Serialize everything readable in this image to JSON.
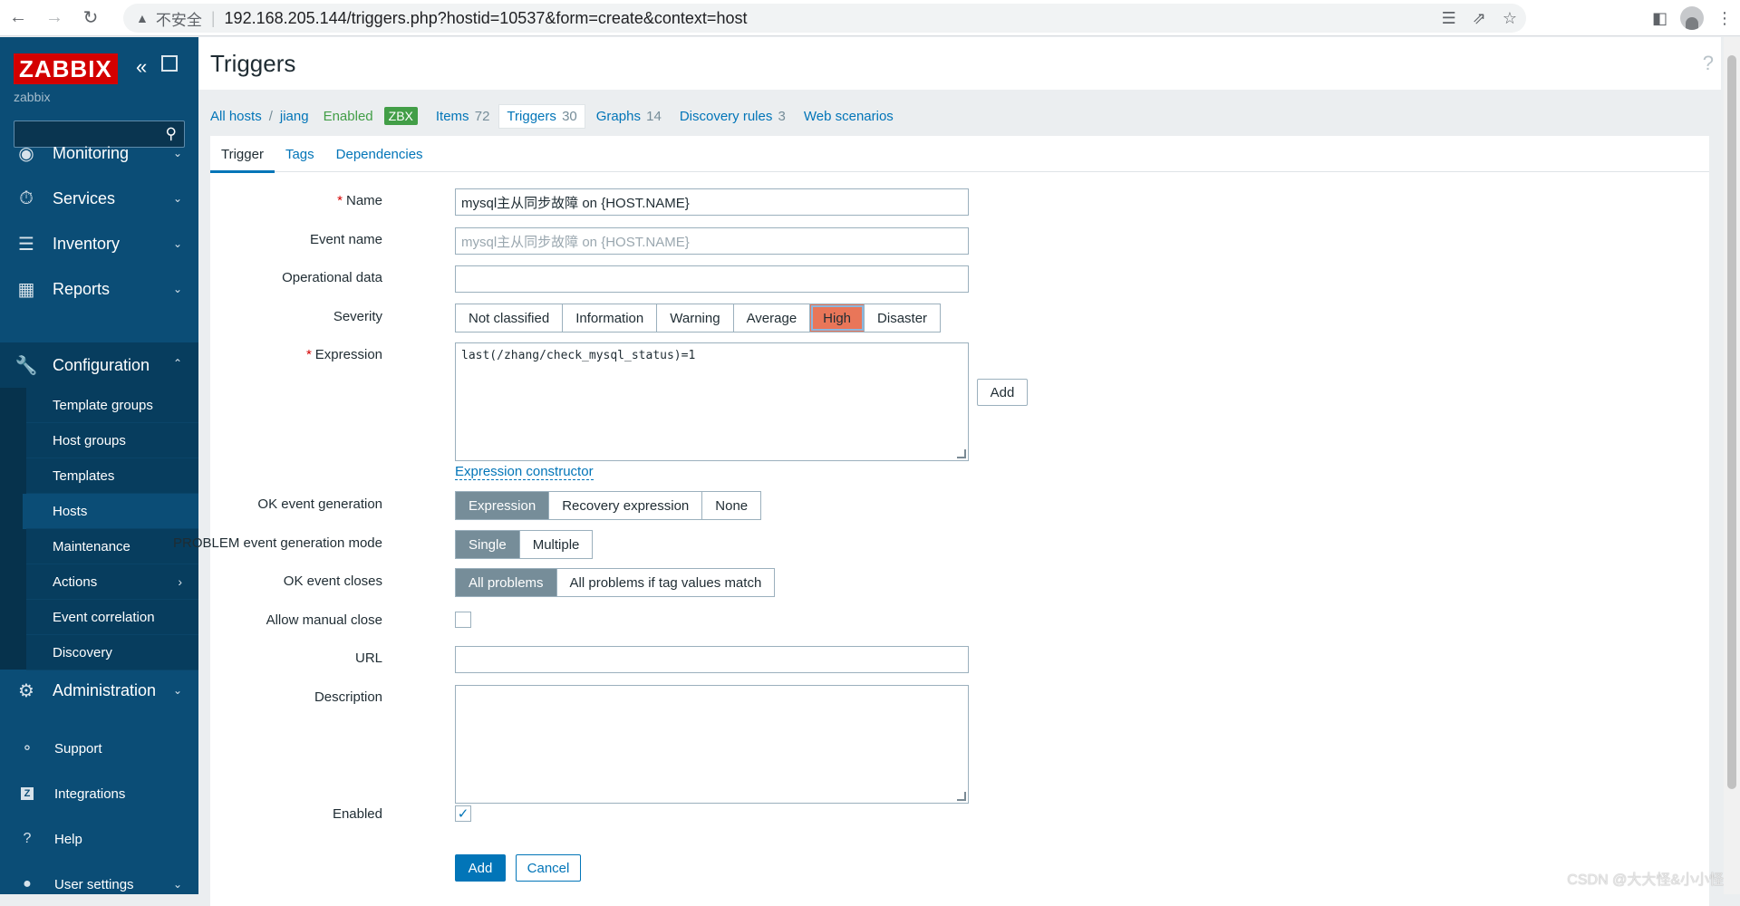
{
  "browser": {
    "security_warning": "不安全",
    "url": "192.168.205.144/triggers.php?hostid=10537&form=create&context=host"
  },
  "sidebar": {
    "logo": "ZABBIX",
    "server_name": "zabbix",
    "menu": [
      {
        "label": "Monitoring",
        "icon": "eye-icon"
      },
      {
        "label": "Services",
        "icon": "stopwatch-icon"
      },
      {
        "label": "Inventory",
        "icon": "list-icon"
      },
      {
        "label": "Reports",
        "icon": "bar-chart-icon"
      },
      {
        "label": "Configuration",
        "icon": "wrench-icon"
      }
    ],
    "configuration_items": [
      {
        "label": "Template groups"
      },
      {
        "label": "Host groups"
      },
      {
        "label": "Templates"
      },
      {
        "label": "Hosts"
      },
      {
        "label": "Maintenance"
      },
      {
        "label": "Actions"
      },
      {
        "label": "Event correlation"
      },
      {
        "label": "Discovery"
      }
    ],
    "administration": "Administration",
    "footer": [
      {
        "label": "Support",
        "icon": "headset-icon"
      },
      {
        "label": "Integrations",
        "icon": "z-icon"
      },
      {
        "label": "Help",
        "icon": "question-icon"
      },
      {
        "label": "User settings",
        "icon": "user-icon"
      }
    ]
  },
  "page": {
    "title": "Triggers",
    "help": "?"
  },
  "host_nav": {
    "all_hosts": "All hosts",
    "host": "jiang",
    "status": "Enabled",
    "badge": "ZBX",
    "tabs": [
      {
        "label": "Items",
        "count": "72"
      },
      {
        "label": "Triggers",
        "count": "30"
      },
      {
        "label": "Graphs",
        "count": "14"
      },
      {
        "label": "Discovery rules",
        "count": "3"
      },
      {
        "label": "Web scenarios",
        "count": ""
      }
    ]
  },
  "form": {
    "tabs": [
      "Trigger",
      "Tags",
      "Dependencies"
    ],
    "name_label": "Name",
    "name_value": "mysql主从同步故障 on {HOST.NAME}",
    "event_name_label": "Event name",
    "event_name_placeholder": "mysql主从同步故障 on {HOST.NAME}",
    "operational_data_label": "Operational data",
    "operational_data_value": "",
    "severity_label": "Severity",
    "severity_options": [
      "Not classified",
      "Information",
      "Warning",
      "Average",
      "High",
      "Disaster"
    ],
    "severity_selected": "High",
    "expression_label": "Expression",
    "expression_value": "last(/zhang/check_mysql_status)=1",
    "expression_add": "Add",
    "expression_constructor": "Expression constructor",
    "ok_event_generation_label": "OK event generation",
    "ok_event_generation_options": [
      "Expression",
      "Recovery expression",
      "None"
    ],
    "problem_mode_label": "PROBLEM event generation mode",
    "problem_mode_options": [
      "Single",
      "Multiple"
    ],
    "ok_event_closes_label": "OK event closes",
    "ok_event_closes_options": [
      "All problems",
      "All problems if tag values match"
    ],
    "allow_manual_close_label": "Allow manual close",
    "allow_manual_close": false,
    "url_label": "URL",
    "url_value": "",
    "description_label": "Description",
    "description_value": "",
    "enabled_label": "Enabled",
    "enabled": true,
    "add_button": "Add",
    "cancel_button": "Cancel"
  },
  "watermark": "CSDN @大大怪&小小怪",
  "colors": {
    "sidebar": "#0b4d76",
    "link": "#0275b8",
    "severity_high": "#e97659",
    "selected_segment": "#768d99",
    "logo_red": "#d40000",
    "enabled_green": "#429e47"
  }
}
